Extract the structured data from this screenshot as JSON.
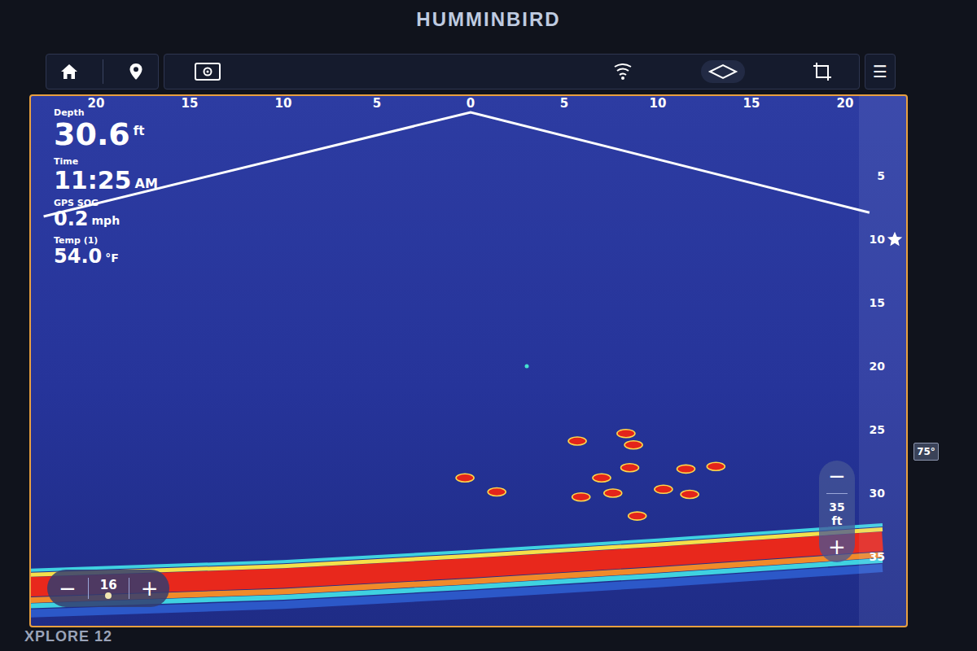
{
  "logo": "HUMMINBIRD",
  "model": "XPLORE 12",
  "toolbar": {
    "menu": "☰"
  },
  "readouts": [
    {
      "label": "Depth",
      "value": "30.6",
      "unit": "ft",
      "kind": "large"
    },
    {
      "label": "Time",
      "value": "11:25",
      "unit": "AM",
      "kind": "medium"
    },
    {
      "label": "GPS SOG",
      "value": "0.2",
      "unit": "mph",
      "kind": "small"
    },
    {
      "label": "Temp (1)",
      "value": "54.0",
      "unit": "°F",
      "kind": "small"
    }
  ],
  "sonar": {
    "range_ticks": [
      "20",
      "15",
      "10",
      "5",
      "0",
      "5",
      "10",
      "15",
      "20"
    ],
    "depth_ticks": [
      "5",
      "10",
      "15",
      "20",
      "25",
      "30",
      "35"
    ],
    "beam_edges": [
      {
        "x": -22.8,
        "depth": 8.2
      },
      {
        "x": 21.3,
        "depth": 7.9
      }
    ],
    "targets": [
      {
        "kind": "fish",
        "x": 5.7,
        "depth": 25.9
      },
      {
        "kind": "fish",
        "x": 8.3,
        "depth": 25.3
      },
      {
        "kind": "fish",
        "x": 8.7,
        "depth": 26.2
      },
      {
        "kind": "fish",
        "x": -0.3,
        "depth": 28.8
      },
      {
        "kind": "fish",
        "x": 1.4,
        "depth": 29.9
      },
      {
        "kind": "fish",
        "x": 7.0,
        "depth": 28.8
      },
      {
        "kind": "fish",
        "x": 8.5,
        "depth": 28.0
      },
      {
        "kind": "fish",
        "x": 11.5,
        "depth": 28.1
      },
      {
        "kind": "fish",
        "x": 13.1,
        "depth": 27.9
      },
      {
        "kind": "fish",
        "x": 5.9,
        "depth": 30.3
      },
      {
        "kind": "fish",
        "x": 7.6,
        "depth": 30.0
      },
      {
        "kind": "fish",
        "x": 10.3,
        "depth": 29.7
      },
      {
        "kind": "fish",
        "x": 11.7,
        "depth": 30.1
      },
      {
        "kind": "fish",
        "x": 8.9,
        "depth": 31.8
      },
      {
        "kind": "speck",
        "x": 3.0,
        "depth": 20.0
      }
    ],
    "bottom": [
      {
        "x": -24,
        "depth": 36.1
      },
      {
        "x": -10,
        "depth": 35.4
      },
      {
        "x": 0,
        "depth": 34.6
      },
      {
        "x": 10,
        "depth": 33.7
      },
      {
        "x": 22,
        "depth": 32.5
      }
    ],
    "zoom": {
      "minus": "−",
      "value": "35",
      "unit": "ft",
      "plus": "+"
    },
    "gain": {
      "minus": "−",
      "value": "16",
      "plus": "+"
    },
    "tilt": "75°"
  }
}
